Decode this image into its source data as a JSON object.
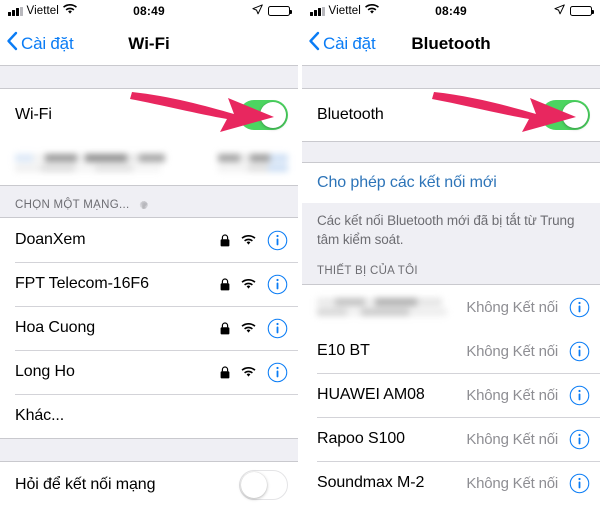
{
  "statusbar": {
    "carrier": "Viettel",
    "time": "08:49",
    "signal_icon": "cellular-bars-icon",
    "wifi_icon": "wifi-icon",
    "location_icon": "location-arrow-icon",
    "battery_icon": "battery-full-icon"
  },
  "annotation": {
    "arrow_color": "#e8275f",
    "arrow_icon": "pink-arrow-pointing-right"
  },
  "wifi_screen": {
    "nav": {
      "back_label": "Cài đặt",
      "title": "Wi-Fi",
      "back_icon": "chevron-left-icon"
    },
    "toggle_row": {
      "label": "Wi-Fi",
      "state": "on",
      "state_color": "#4cd561"
    },
    "connected_network": {
      "censored": true,
      "label": "",
      "status": ""
    },
    "section_header": {
      "text": "CHỌN MỘT MẠNG...",
      "spinner_icon": "activity-spinner-icon"
    },
    "networks": [
      {
        "name": "DoanXem",
        "locked": true,
        "lock_icon": "lock-icon",
        "wifi_icon": "wifi-icon",
        "info_icon": "info-circle-icon"
      },
      {
        "name": "FPT Telecom-16F6",
        "locked": true,
        "lock_icon": "lock-icon",
        "wifi_icon": "wifi-icon",
        "info_icon": "info-circle-icon"
      },
      {
        "name": "Hoa Cuong",
        "locked": true,
        "lock_icon": "lock-icon",
        "wifi_icon": "wifi-icon",
        "info_icon": "info-circle-icon"
      },
      {
        "name": "Long Ho",
        "locked": true,
        "lock_icon": "lock-icon",
        "wifi_icon": "wifi-icon",
        "info_icon": "info-circle-icon"
      },
      {
        "name": "Khác...",
        "locked": false,
        "lock_icon": "",
        "wifi_icon": "",
        "info_icon": ""
      }
    ],
    "ask_row": {
      "label": "Hỏi để kết nối mạng",
      "state": "off"
    }
  },
  "bluetooth_screen": {
    "nav": {
      "back_label": "Cài đặt",
      "title": "Bluetooth",
      "back_icon": "chevron-left-icon"
    },
    "toggle_row": {
      "label": "Bluetooth",
      "state": "on",
      "state_color": "#4cd561"
    },
    "allow_link": {
      "label": "Cho phép các kết nối mới",
      "color": "#2d74b8"
    },
    "description": "Các kết nối Bluetooth mới đã bị tắt từ Trung tâm kiểm soát.",
    "section_header": {
      "text": "THIẾT BỊ CỦA TÔI"
    },
    "devices": [
      {
        "name": "",
        "censored": true,
        "status": "Không Kết nối",
        "info_icon": "info-circle-icon"
      },
      {
        "name": "E10 BT",
        "censored": false,
        "status": "Không Kết nối",
        "info_icon": "info-circle-icon"
      },
      {
        "name": "HUAWEI AM08",
        "censored": false,
        "status": "Không Kết nối",
        "info_icon": "info-circle-icon"
      },
      {
        "name": "Rapoo S100",
        "censored": false,
        "status": "Không Kết nối",
        "info_icon": "info-circle-icon"
      },
      {
        "name": "Soundmax M-2",
        "censored": false,
        "status": "Không Kết nối",
        "info_icon": "info-circle-icon"
      }
    ]
  }
}
